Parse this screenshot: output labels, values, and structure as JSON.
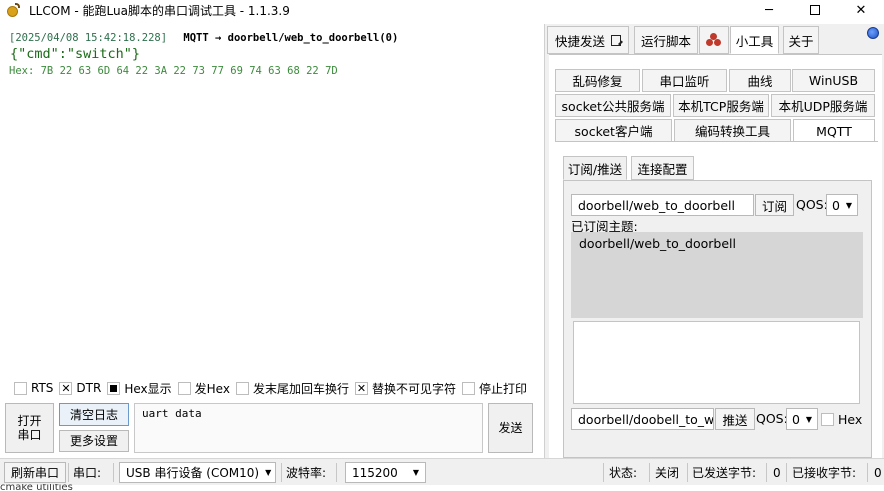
{
  "window": {
    "title": "LLCOM - 能跑Lua脚本的串口调试工具 - 1.1.3.9",
    "minimize": "─",
    "close": "✕"
  },
  "console": {
    "timestamp": "[2025/04/08 15:42:18.228]",
    "tag": "MQTT → doorbell/web_to_doorbell(0)",
    "payload": "{\"cmd\":\"switch\"}",
    "hex": "Hex: 7B 22 63 6D 64 22 3A 22 73 77 69 74 63 68 22 7D"
  },
  "options": {
    "rts": {
      "label": "RTS",
      "checked": false
    },
    "dtr": {
      "label": "DTR",
      "mark": "✕"
    },
    "hex_display": {
      "label": "Hex显示"
    },
    "send_hex": {
      "label": "发Hex",
      "checked": false
    },
    "append_crlf": {
      "label": "发末尾加回车换行",
      "checked": false
    },
    "replace_invisible": {
      "label": "替换不可见字符",
      "mark": "✕"
    },
    "stop_print": {
      "label": "停止打印",
      "checked": false
    }
  },
  "controls": {
    "open_port_line1": "打开",
    "open_port_line2": "串口",
    "clear_log": "清空日志",
    "more_settings": "更多设置",
    "send_input_value": "uart data",
    "send": "发送"
  },
  "statusbar": {
    "refresh_port": "刷新串口",
    "port_label": "串口:",
    "port_value": "USB 串行设备 (COM10)",
    "baud_label": "波特率:",
    "baud_value": "115200",
    "state_label": "状态:",
    "state_value": "关闭",
    "sent_label": "已发送字节:",
    "sent_value": "0",
    "recv_label": "已接收字节:",
    "recv_value": "0",
    "leftover_text": "cmake utilities"
  },
  "right_tabs": {
    "quick_send": "快捷发送",
    "run_script": "运行脚本",
    "tools": "小工具",
    "about": "关于"
  },
  "tool_tabs": {
    "row1": [
      "乱码修复",
      "串口监听",
      "曲线",
      "WinUSB"
    ],
    "row2": [
      "socket公共服务端",
      "本机TCP服务端",
      "本机UDP服务端"
    ],
    "row3": [
      "socket客户端",
      "编码转换工具",
      "MQTT"
    ]
  },
  "mqtt": {
    "sub_tabs": [
      "订阅/推送",
      "连接配置"
    ],
    "subscribe_topic": "doorbell/web_to_doorbell",
    "subscribe_button": "订阅",
    "qos_label": "QOS:",
    "qos_value": "0",
    "subscribed_label": "已订阅主题:",
    "subscribed_items": [
      "doorbell/web_to_doorbell"
    ],
    "publish_topic": "doorbell/doobell_to_web",
    "publish_button": "推送",
    "publish_qos_value": "0",
    "hex_label": "Hex"
  }
}
